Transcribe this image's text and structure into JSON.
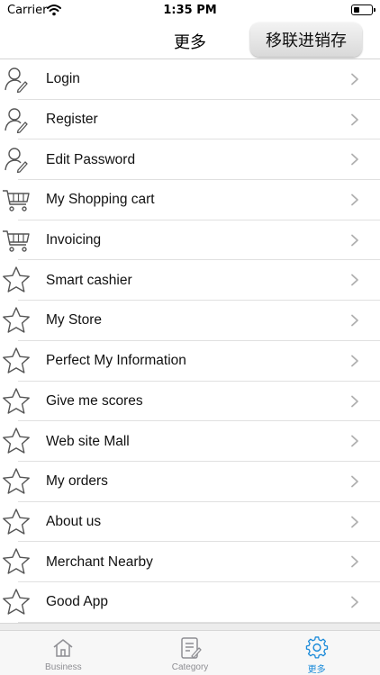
{
  "status_bar": {
    "carrier": "Carrier",
    "time": "1:35 PM",
    "battery_level": 0.35
  },
  "nav": {
    "title": "更多",
    "action_label": "移联进销存"
  },
  "menu": {
    "items": [
      {
        "label": "Login",
        "icon": "user-edit-icon"
      },
      {
        "label": "Register",
        "icon": "user-edit-icon"
      },
      {
        "label": "Edit Password",
        "icon": "user-edit-icon"
      },
      {
        "label": "My Shopping cart",
        "icon": "cart-icon"
      },
      {
        "label": "Invoicing",
        "icon": "cart-icon"
      },
      {
        "label": "Smart cashier",
        "icon": "star-icon"
      },
      {
        "label": "My Store",
        "icon": "star-icon"
      },
      {
        "label": "Perfect My Information",
        "icon": "star-icon"
      },
      {
        "label": "Give me scores",
        "icon": "star-icon"
      },
      {
        "label": "Web site Mall",
        "icon": "star-icon"
      },
      {
        "label": "My orders",
        "icon": "star-icon"
      },
      {
        "label": "About us",
        "icon": "star-icon"
      },
      {
        "label": "Merchant Nearby",
        "icon": "star-icon"
      },
      {
        "label": "Good App",
        "icon": "star-icon"
      }
    ]
  },
  "tabs": [
    {
      "label": "Business",
      "icon": "home-icon",
      "active": false
    },
    {
      "label": "Category",
      "icon": "document-icon",
      "active": false
    },
    {
      "label": "更多",
      "icon": "gear-icon",
      "active": true
    }
  ],
  "colors": {
    "active_tab": "#1a8ad9",
    "inactive_tab": "#8e8e93",
    "icon_stroke": "#555555"
  }
}
